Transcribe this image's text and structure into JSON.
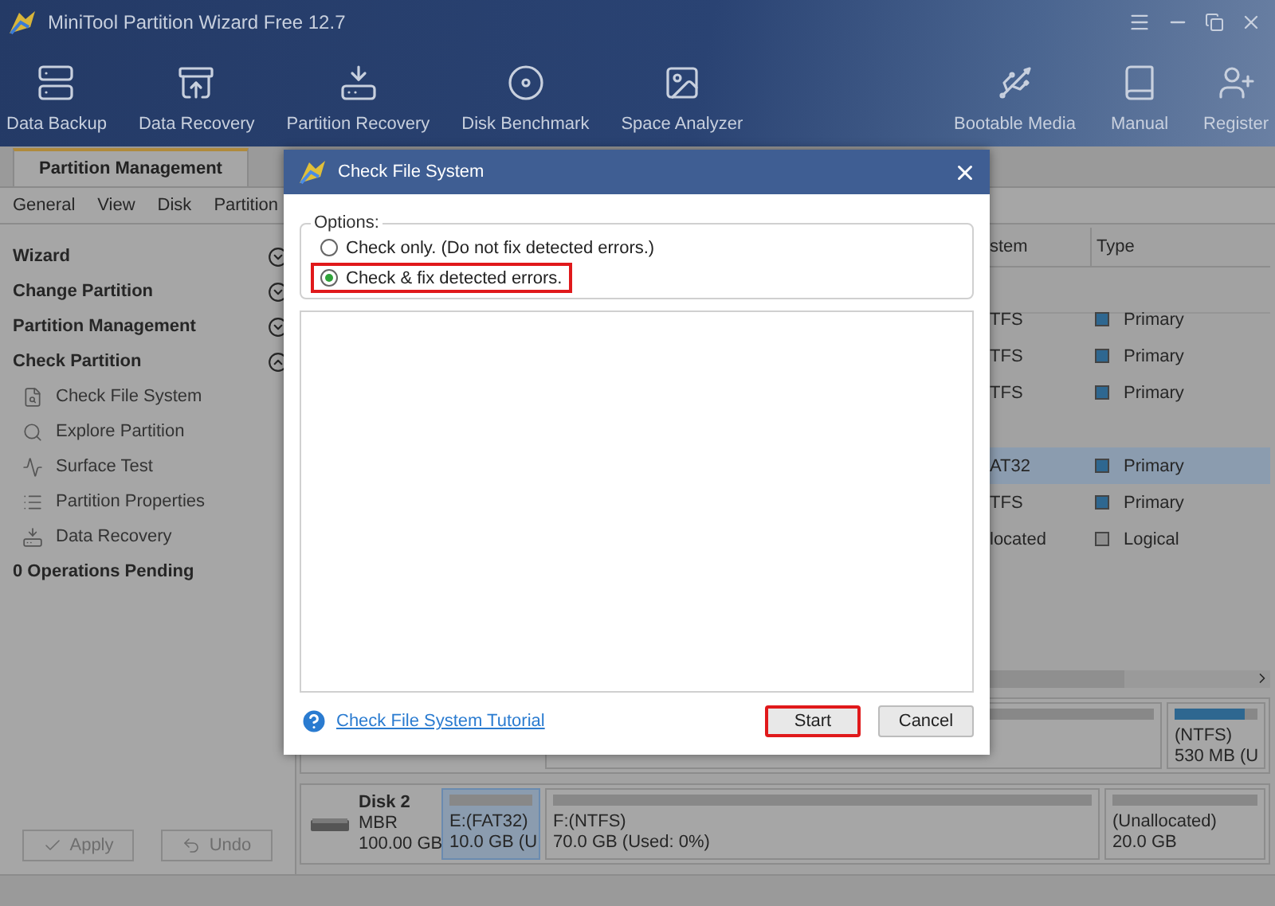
{
  "window": {
    "title": "MiniTool Partition Wizard Free 12.7"
  },
  "toolbar": {
    "left": [
      {
        "label": "Data Backup"
      },
      {
        "label": "Data Recovery"
      },
      {
        "label": "Partition Recovery"
      },
      {
        "label": "Disk Benchmark"
      },
      {
        "label": "Space Analyzer"
      }
    ],
    "right": [
      {
        "label": "Bootable Media"
      },
      {
        "label": "Manual"
      },
      {
        "label": "Register"
      }
    ]
  },
  "tabs": [
    {
      "label": "Partition Management",
      "selected": true
    }
  ],
  "menu": [
    "General",
    "View",
    "Disk",
    "Partition"
  ],
  "sidebar": {
    "sections": [
      {
        "label": "Wizard",
        "expanded": false
      },
      {
        "label": "Change Partition",
        "expanded": false
      },
      {
        "label": "Partition Management",
        "expanded": false
      },
      {
        "label": "Check Partition",
        "expanded": true,
        "children": [
          {
            "label": "Check File System"
          },
          {
            "label": "Explore Partition"
          },
          {
            "label": "Surface Test"
          },
          {
            "label": "Partition Properties"
          },
          {
            "label": "Data Recovery"
          }
        ]
      }
    ],
    "pending": "0 Operations Pending",
    "buttons": [
      {
        "label": "Apply",
        "disabled": true
      },
      {
        "label": "Undo",
        "disabled": true
      }
    ]
  },
  "table": {
    "columns": [
      "stem",
      "Type"
    ],
    "rows": [
      {
        "kind": "disk"
      },
      {
        "kind": "partition",
        "cells": [
          "TFS",
          "Primary"
        ],
        "color": "#2e6790",
        "selected": false
      },
      {
        "kind": "partition",
        "cells": [
          "TFS",
          "Primary"
        ],
        "color": "#2e6790",
        "selected": false
      },
      {
        "kind": "partition",
        "cells": [
          "TFS",
          "Primary"
        ],
        "color": "#2e6790",
        "selected": false
      },
      {
        "kind": "disk"
      },
      {
        "kind": "partition",
        "cells": [
          "AT32",
          "Primary"
        ],
        "color": "#2e6790",
        "selected": true
      },
      {
        "kind": "partition",
        "cells": [
          "TFS",
          "Primary"
        ],
        "color": "#2e6790",
        "selected": false
      },
      {
        "kind": "partition",
        "cells": [
          "located",
          "Logical"
        ],
        "color": "#8f8f8f",
        "selected": false
      }
    ]
  },
  "disk_map": {
    "disks": [
      {
        "partitions": [
          {
            "selected": false
          },
          {
            "name": "(NTFS)",
            "size": "530 MB (U",
            "level": 0.85,
            "selected": false
          }
        ]
      },
      {
        "name": "Disk 2",
        "scheme": "MBR",
        "size": "100.00 GB",
        "partitions": [
          {
            "name": "E:(FAT32)",
            "size": "10.0 GB (U",
            "selected": true
          },
          {
            "name": "F:(NTFS)",
            "size": "70.0 GB (Used: 0%)",
            "selected": false
          },
          {
            "name": "(Unallocated)",
            "size": "20.0 GB",
            "selected": false
          }
        ]
      }
    ]
  },
  "dialog": {
    "title": "Check File System",
    "options_label": "Options:",
    "options": [
      {
        "label": "Check only. (Do not fix detected errors.)",
        "selected": false,
        "highlighted": false
      },
      {
        "label": "Check & fix detected errors.",
        "selected": true,
        "highlighted": true
      }
    ],
    "link": "Check File System Tutorial",
    "buttons": [
      {
        "label": "Start",
        "highlighted": true
      },
      {
        "label": "Cancel",
        "highlighted": false
      }
    ]
  }
}
